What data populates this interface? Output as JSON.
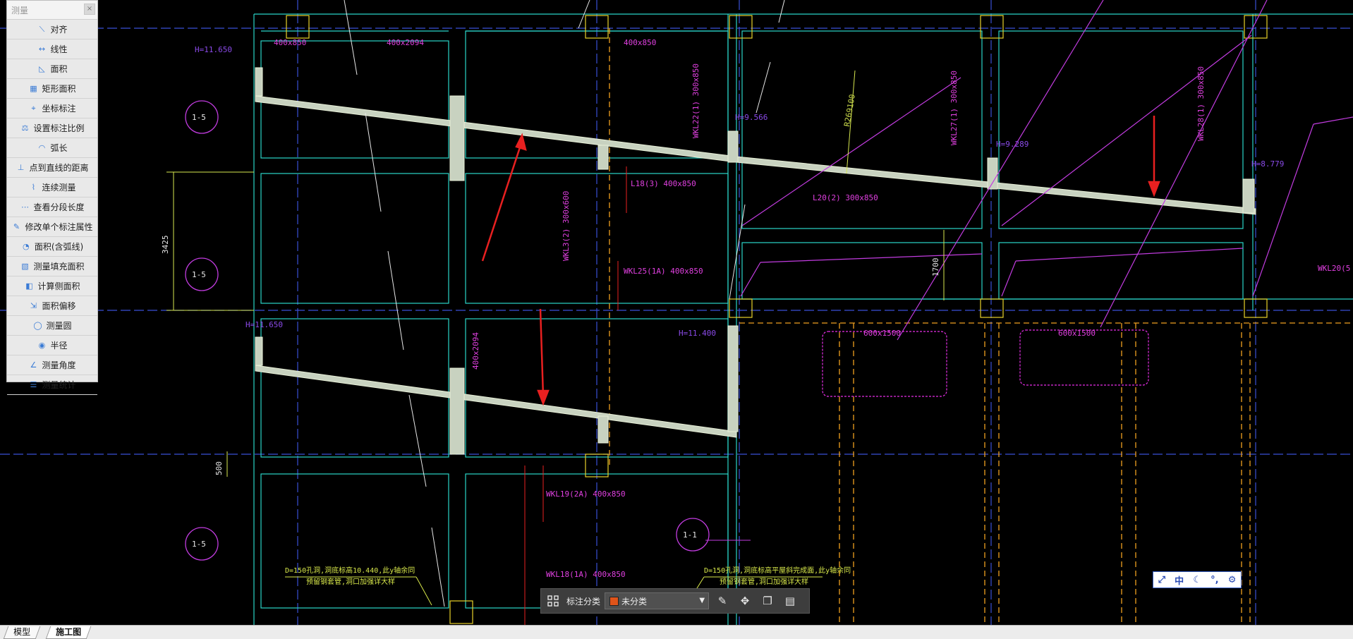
{
  "measure_panel": {
    "title": "测量",
    "close": "×",
    "tools": [
      {
        "label": "对齐",
        "icon": "align-icon"
      },
      {
        "label": "线性",
        "icon": "linear-icon"
      },
      {
        "label": "面积",
        "icon": "area-icon"
      },
      {
        "label": "矩形面积",
        "icon": "rect-area-icon"
      },
      {
        "label": "坐标标注",
        "icon": "coordinate-icon"
      },
      {
        "label": "设置标注比例",
        "icon": "scale-icon"
      },
      {
        "label": "弧长",
        "icon": "arc-icon"
      },
      {
        "label": "点到直线的距离",
        "icon": "point-line-icon"
      },
      {
        "label": "连续测量",
        "icon": "continuous-icon"
      },
      {
        "label": "查看分段长度",
        "icon": "segment-icon"
      },
      {
        "label": "修改单个标注属性",
        "icon": "edit-dim-icon"
      },
      {
        "label": "面积(含弧线)",
        "icon": "arc-area-icon"
      },
      {
        "label": "测量填充面积",
        "icon": "fill-area-icon"
      },
      {
        "label": "计算侧面积",
        "icon": "side-area-icon"
      },
      {
        "label": "面积偏移",
        "icon": "offset-icon"
      },
      {
        "label": "测量圆",
        "icon": "circle-icon"
      },
      {
        "label": "半径",
        "icon": "radius-icon"
      },
      {
        "label": "测量角度",
        "icon": "angle-icon"
      },
      {
        "label": "测量统计",
        "icon": "stats-icon"
      }
    ]
  },
  "tabs": [
    {
      "label": "模型"
    },
    {
      "label": "施工图",
      "active": true
    }
  ],
  "annotation_toolbar": {
    "label": "标注分类",
    "category_value": "未分类",
    "category_color": "#e0541a"
  },
  "ime_bar": {
    "mode_label": "中"
  },
  "drawing_labels": {
    "h_11650": "H=11.650",
    "h_11650b": "H=11.650",
    "h_11400": "H=11.400",
    "h_9566": "H=9.566",
    "h_9289": "H=9.289",
    "h_8779": "H=8.779",
    "s_400x850_a": "400x850",
    "s_400x2094_a": "400x2094",
    "s_400x850_b": "400x850",
    "s_400x2094_b": "400x2094",
    "s_600x1500_a": "600x1500",
    "s_600x1500_b": "600x1500",
    "wkl22": "WKL22(1) 300x850",
    "wkl27": "WKL27(1) 300x850",
    "wkl28": "WKL28(1) 300x850",
    "wkl25": "WKL25(1A) 400x850",
    "wkl3": "WKL3(2) 300x600",
    "wkl19": "WKL19(2A) 400x850",
    "wkl18": "WKL18(1A) 400x850",
    "wkl20": "WKL20(5",
    "l18": "L18(3) 400x850",
    "l20": "L20(2) 300x850",
    "r269100": "R269100",
    "sec_1_5_a": "1-5",
    "sec_1_5_b": "1-5",
    "sec_1_5_c": "1-5",
    "sec_1_1": "1-1",
    "dim_3425": "3425",
    "dim_1700": "1700",
    "dim_500": "500",
    "note1_line1": "D=150孔洞,洞底标高10.440,此y轴余同",
    "note1_line2": "预留钢套管,洞口加强详大样",
    "note2_line1": "D=150孔洞,洞底标高平屋斜完成面,此y轴余同",
    "note2_line2": "预留钢套管,洞口加强详大样"
  }
}
